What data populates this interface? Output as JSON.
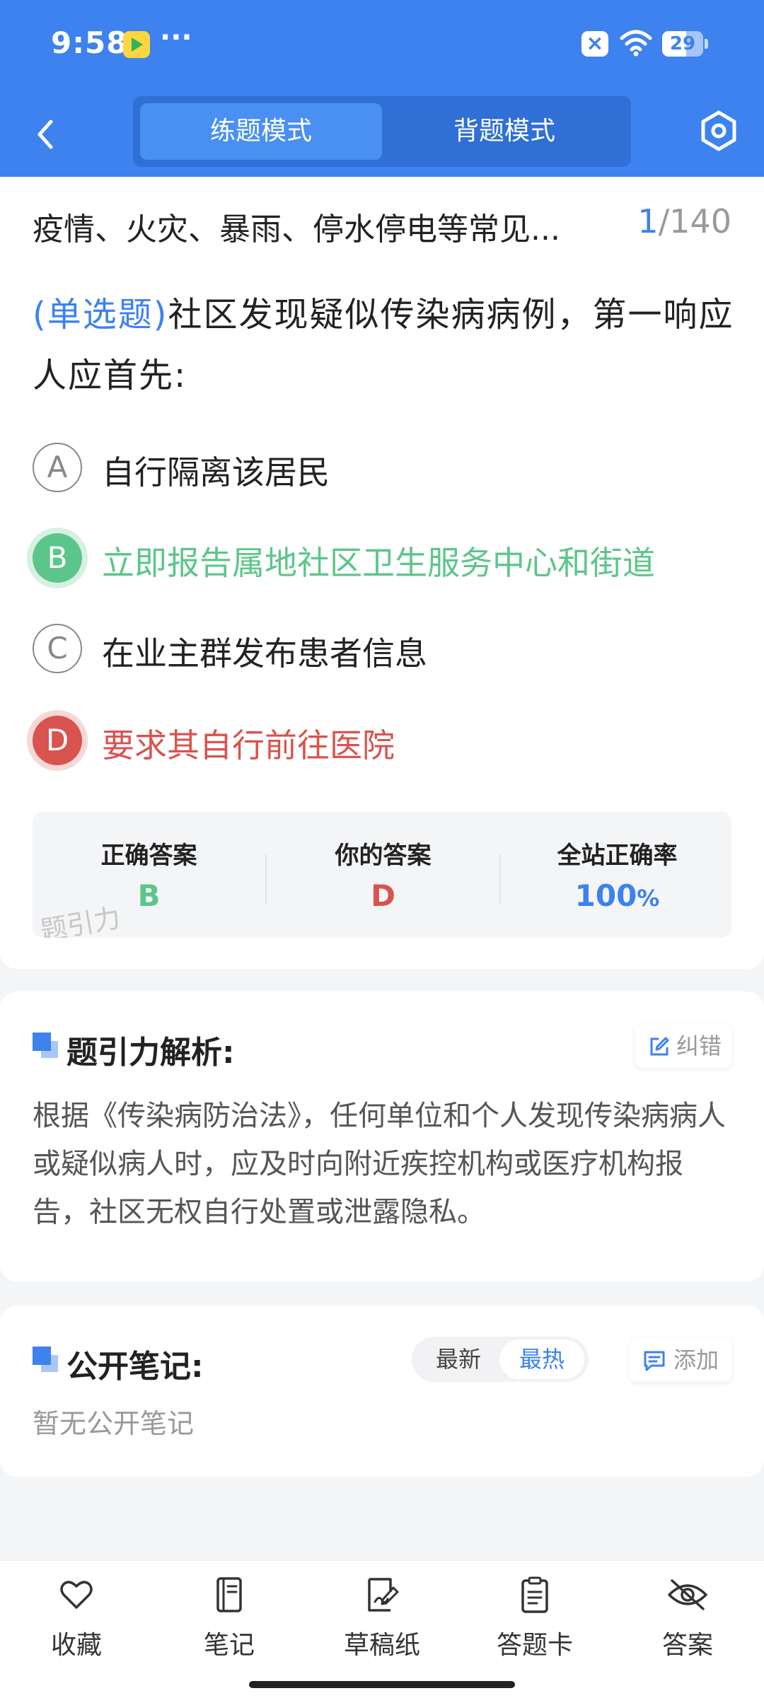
{
  "status_bar": {
    "time": "9:58",
    "dots": "···",
    "battery": "29"
  },
  "header": {
    "tabs": [
      {
        "label": "练题模式",
        "active": true
      },
      {
        "label": "背题模式",
        "active": false
      }
    ],
    "accent_color": "#3d82ee"
  },
  "topic": {
    "title": "疫情、火灾、暴雨、停水停电等常见...",
    "current": "1",
    "total": "/140"
  },
  "question": {
    "type_label": "(单选题)",
    "text": "社区发现疑似传染病病例，第一响应人应首先:",
    "options": [
      {
        "letter": "A",
        "text": "自行隔离该居民",
        "state": "normal"
      },
      {
        "letter": "B",
        "text": "立即报告属地社区卫生服务中心和街道",
        "state": "correct"
      },
      {
        "letter": "C",
        "text": "在业主群发布患者信息",
        "state": "normal"
      },
      {
        "letter": "D",
        "text": "要求其自行前往医院",
        "state": "wrong"
      }
    ]
  },
  "result": {
    "correct_label": "正确答案",
    "correct_value": "B",
    "yours_label": "你的答案",
    "yours_value": "D",
    "rate_label": "全站正确率",
    "rate_value": "100",
    "rate_unit": "%",
    "watermark": "题引力",
    "colors": {
      "correct": "#5cc68a",
      "wrong": "#d9534f",
      "rate": "#3d82ee"
    }
  },
  "analysis": {
    "title": "题引力解析:",
    "report_button": "纠错",
    "text": "根据《传染病防治法》，任何单位和个人发现传染病病人或疑似病人时，应及时向附近疾控机构或医疗机构报告，社区无权自行处置或泄露隐私。"
  },
  "notes": {
    "title": "公开笔记:",
    "sort_latest": "最新",
    "sort_hot": "最热",
    "add_button": "添加",
    "empty_text": "暂无公开笔记"
  },
  "bottom_nav": [
    {
      "label": "收藏",
      "icon": "heart-icon"
    },
    {
      "label": "笔记",
      "icon": "notebook-icon"
    },
    {
      "label": "草稿纸",
      "icon": "draft-paper-icon"
    },
    {
      "label": "答题卡",
      "icon": "answer-sheet-icon"
    },
    {
      "label": "答案",
      "icon": "eye-off-icon"
    }
  ]
}
